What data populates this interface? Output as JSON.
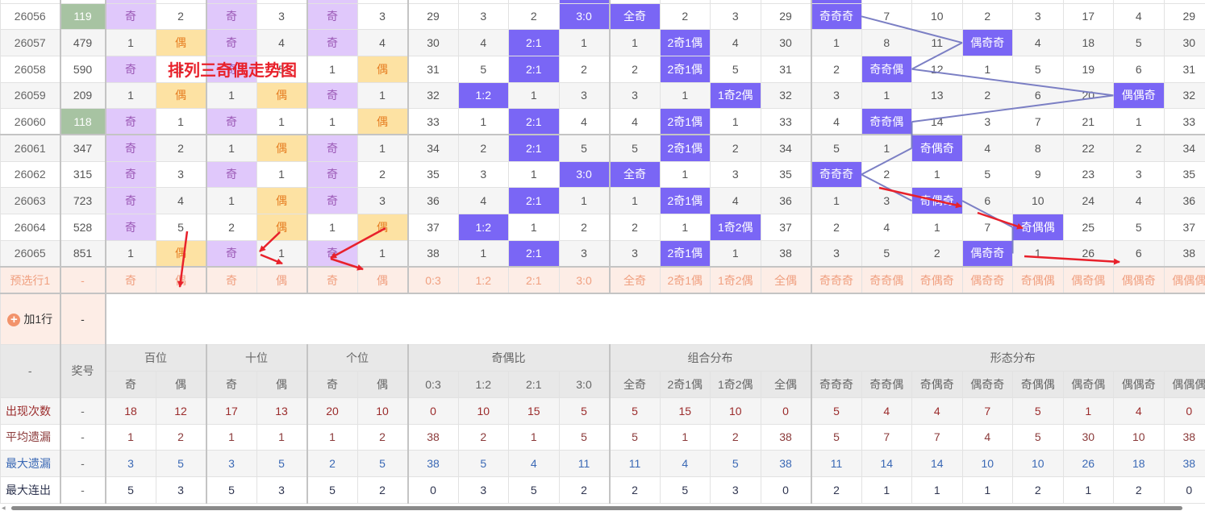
{
  "title": "排列三奇偶走势图",
  "colors": {
    "odd_bg": "#e0c8fb",
    "even_bg": "#fde2a3",
    "hit_blue": "#7a66f5",
    "line": "#7b7fc4",
    "arrow": "#e8212b",
    "special": "#a7c3a2"
  },
  "rows": [
    {
      "issue": "26056",
      "award": "119",
      "special": true,
      "cells": [
        "奇",
        "2",
        "奇",
        "3",
        "奇",
        "3",
        "29",
        "3",
        "2",
        "3:0",
        "全奇",
        "2",
        "3",
        "29",
        "奇奇奇",
        "7",
        "10",
        "2",
        "3",
        "17",
        "4",
        "29"
      ],
      "hits": [
        0,
        2,
        4,
        9,
        10,
        14
      ]
    },
    {
      "issue": "26057",
      "award": "479",
      "special": false,
      "cells": [
        "1",
        "偶",
        "奇",
        "4",
        "奇",
        "4",
        "30",
        "4",
        "2:1",
        "1",
        "1",
        "2奇1偶",
        "4",
        "30",
        "1",
        "8",
        "11",
        "偶奇奇",
        "4",
        "18",
        "5",
        "30"
      ],
      "hits": [
        1,
        2,
        4,
        8,
        11,
        17
      ]
    },
    {
      "issue": "26058",
      "award": "590",
      "special": false,
      "cells": [
        "奇",
        "1",
        "奇",
        "5",
        "1",
        "偶",
        "31",
        "5",
        "2:1",
        "2",
        "2",
        "2奇1偶",
        "5",
        "31",
        "2",
        "奇奇偶",
        "12",
        "1",
        "5",
        "19",
        "6",
        "31"
      ],
      "hits": [
        0,
        2,
        5,
        8,
        11,
        15
      ]
    },
    {
      "issue": "26059",
      "award": "209",
      "special": false,
      "cells": [
        "1",
        "偶",
        "1",
        "偶",
        "奇",
        "1",
        "32",
        "1:2",
        "1",
        "3",
        "3",
        "1",
        "1奇2偶",
        "32",
        "3",
        "1",
        "13",
        "2",
        "6",
        "20",
        "偶偶奇",
        "32"
      ],
      "hits": [
        1,
        3,
        4,
        7,
        12,
        20
      ]
    },
    {
      "issue": "26060",
      "award": "118",
      "special": true,
      "cells": [
        "奇",
        "1",
        "奇",
        "1",
        "1",
        "偶",
        "33",
        "1",
        "2:1",
        "4",
        "4",
        "2奇1偶",
        "1",
        "33",
        "4",
        "奇奇偶",
        "14",
        "3",
        "7",
        "21",
        "1",
        "33"
      ],
      "hits": [
        0,
        2,
        5,
        8,
        11,
        15
      ]
    },
    {
      "issue": "26061",
      "award": "347",
      "special": false,
      "cells": [
        "奇",
        "2",
        "1",
        "偶",
        "奇",
        "1",
        "34",
        "2",
        "2:1",
        "5",
        "5",
        "2奇1偶",
        "2",
        "34",
        "5",
        "1",
        "奇偶奇",
        "4",
        "8",
        "22",
        "2",
        "34"
      ],
      "hits": [
        0,
        3,
        4,
        8,
        11,
        16
      ]
    },
    {
      "issue": "26062",
      "award": "315",
      "special": false,
      "cells": [
        "奇",
        "3",
        "奇",
        "1",
        "奇",
        "2",
        "35",
        "3",
        "1",
        "3:0",
        "全奇",
        "1",
        "3",
        "35",
        "奇奇奇",
        "2",
        "1",
        "5",
        "9",
        "23",
        "3",
        "35"
      ],
      "hits": [
        0,
        2,
        4,
        9,
        10,
        14
      ]
    },
    {
      "issue": "26063",
      "award": "723",
      "special": false,
      "cells": [
        "奇",
        "4",
        "1",
        "偶",
        "奇",
        "3",
        "36",
        "4",
        "2:1",
        "1",
        "1",
        "2奇1偶",
        "4",
        "36",
        "1",
        "3",
        "奇偶奇",
        "6",
        "10",
        "24",
        "4",
        "36"
      ],
      "hits": [
        0,
        3,
        4,
        8,
        11,
        16
      ]
    },
    {
      "issue": "26064",
      "award": "528",
      "special": false,
      "cells": [
        "奇",
        "5",
        "2",
        "偶",
        "1",
        "偶",
        "37",
        "1:2",
        "1",
        "2",
        "2",
        "1",
        "1奇2偶",
        "37",
        "2",
        "4",
        "1",
        "7",
        "奇偶偶",
        "25",
        "5",
        "37"
      ],
      "hits": [
        0,
        3,
        5,
        7,
        12,
        18
      ]
    },
    {
      "issue": "26065",
      "award": "851",
      "special": false,
      "cells": [
        "1",
        "偶",
        "奇",
        "1",
        "奇",
        "1",
        "38",
        "1",
        "2:1",
        "3",
        "3",
        "2奇1偶",
        "1",
        "38",
        "3",
        "5",
        "2",
        "偶奇奇",
        "1",
        "26",
        "6",
        "38"
      ],
      "hits": [
        1,
        2,
        4,
        8,
        11,
        17
      ]
    }
  ],
  "predict": {
    "label": "预选行1",
    "award": "-",
    "cells": [
      "奇",
      "偶",
      "奇",
      "偶",
      "奇",
      "偶",
      "0:3",
      "1:2",
      "2:1",
      "3:0",
      "全奇",
      "2奇1偶",
      "1奇2偶",
      "全偶",
      "奇奇奇",
      "奇奇偶",
      "奇偶奇",
      "偶奇奇",
      "奇偶偶",
      "偶奇偶",
      "偶偶奇",
      "偶偶偶"
    ]
  },
  "add_row": {
    "label": "加1行",
    "award": "-"
  },
  "header": {
    "corner": "-",
    "award": "奖号",
    "groups": [
      {
        "label": "百位",
        "span": 2
      },
      {
        "label": "十位",
        "span": 2
      },
      {
        "label": "个位",
        "span": 2
      },
      {
        "label": "奇偶比",
        "span": 4
      },
      {
        "label": "组合分布",
        "span": 4
      },
      {
        "label": "形态分布",
        "span": 8
      }
    ],
    "subs": [
      "奇",
      "偶",
      "奇",
      "偶",
      "奇",
      "偶",
      "0:3",
      "1:2",
      "2:1",
      "3:0",
      "全奇",
      "2奇1偶",
      "1奇2偶",
      "全偶",
      "奇奇奇",
      "奇奇偶",
      "奇偶奇",
      "偶奇奇",
      "奇偶偶",
      "偶奇偶",
      "偶偶奇",
      "偶偶偶"
    ]
  },
  "stats": [
    {
      "label": "出现次数",
      "award": "-",
      "values": [
        "18",
        "12",
        "17",
        "13",
        "20",
        "10",
        "0",
        "10",
        "15",
        "5",
        "5",
        "15",
        "10",
        "0",
        "5",
        "4",
        "4",
        "7",
        "5",
        "1",
        "4",
        "0"
      ]
    },
    {
      "label": "平均遗漏",
      "award": "-",
      "values": [
        "1",
        "2",
        "1",
        "1",
        "1",
        "2",
        "38",
        "2",
        "1",
        "5",
        "5",
        "1",
        "2",
        "38",
        "5",
        "7",
        "7",
        "4",
        "5",
        "30",
        "10",
        "38"
      ]
    },
    {
      "label": "最大遗漏",
      "award": "-",
      "values": [
        "3",
        "5",
        "3",
        "5",
        "2",
        "5",
        "38",
        "5",
        "4",
        "11",
        "11",
        "4",
        "5",
        "38",
        "11",
        "14",
        "14",
        "10",
        "10",
        "26",
        "18",
        "38"
      ]
    },
    {
      "label": "最大连出",
      "award": "-",
      "values": [
        "5",
        "3",
        "5",
        "3",
        "5",
        "2",
        "0",
        "3",
        "5",
        "2",
        "2",
        "5",
        "3",
        "0",
        "2",
        "1",
        "1",
        "1",
        "2",
        "1",
        "2",
        "0"
      ]
    }
  ]
}
